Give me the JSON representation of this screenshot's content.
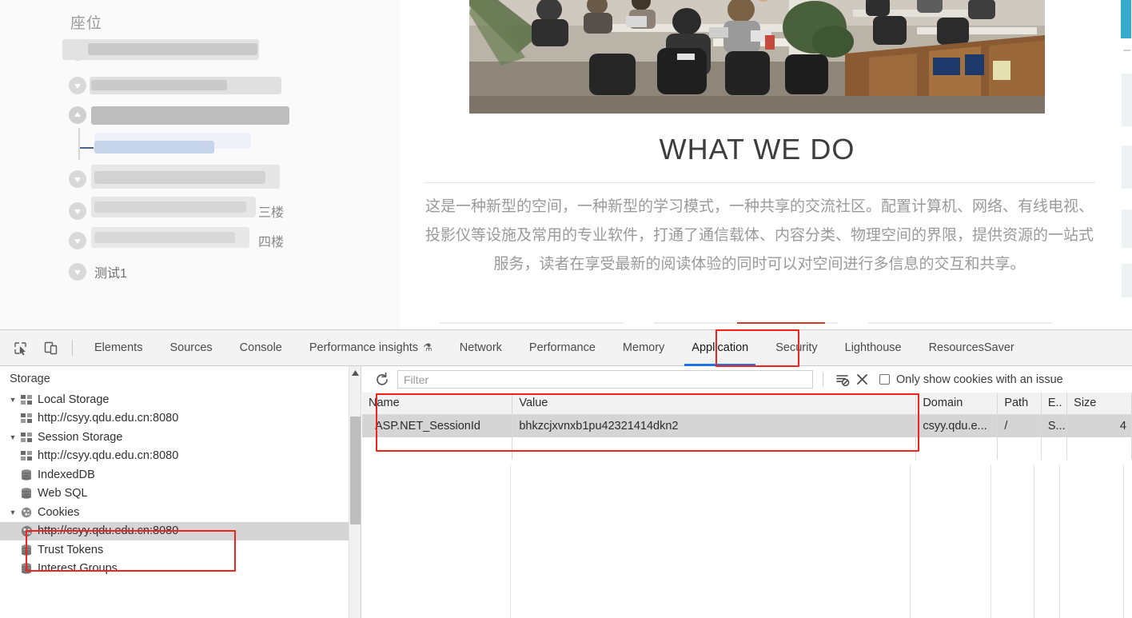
{
  "webpage": {
    "sidebar": {
      "title": "座位",
      "items": [
        {
          "label": "",
          "state": "down"
        },
        {
          "label": "",
          "state": "down"
        },
        {
          "label": "",
          "state": "up"
        },
        {
          "label": "",
          "state": "child"
        },
        {
          "label": "",
          "state": "down"
        },
        {
          "label": "三楼",
          "state": "down"
        },
        {
          "label": "四楼",
          "state": "down"
        },
        {
          "label": "测试1",
          "state": "down"
        }
      ]
    },
    "content": {
      "hero_alt": "study-space-photo",
      "heading": "WHAT WE DO",
      "paragraph": "这是一种新型的空间，一种新型的学习模式，一种共享的交流社区。配置计算机、网络、有线电视、投影仪等设施及常用的专业软件，打通了通信载体、内容分类、物理空间的界限，提供资源的一站式服务，读者在享受最新的阅读体验的同时可以对空间进行多信息的交互和共享。"
    },
    "scrollbar": {
      "thumb_color": "#36aacb"
    }
  },
  "devtools": {
    "toolbar": {
      "inspect_icon": "inspect-element-icon",
      "device_icon": "device-toolbar-icon",
      "tabs": [
        {
          "id": "elements",
          "label": "Elements",
          "active": false
        },
        {
          "id": "sources",
          "label": "Sources",
          "active": false
        },
        {
          "id": "console",
          "label": "Console",
          "active": false
        },
        {
          "id": "performance-insights",
          "label": "Performance insights",
          "active": false,
          "badge": "flask-icon"
        },
        {
          "id": "network",
          "label": "Network",
          "active": false
        },
        {
          "id": "performance",
          "label": "Performance",
          "active": false
        },
        {
          "id": "memory",
          "label": "Memory",
          "active": false
        },
        {
          "id": "application",
          "label": "Application",
          "active": true
        },
        {
          "id": "security",
          "label": "Security",
          "active": false
        },
        {
          "id": "lighthouse",
          "label": "Lighthouse",
          "active": false
        },
        {
          "id": "resources-saver",
          "label": "ResourcesSaver",
          "active": false
        }
      ],
      "active_tab_underline_color": "#1a73e8",
      "annotation_color": "#f0231e"
    },
    "storage_panel": {
      "title": "Storage",
      "tree": [
        {
          "label": "Local Storage",
          "icon": "storage-grid-icon",
          "expanded": true,
          "level": 0,
          "selected": false
        },
        {
          "label": "http://csyy.qdu.edu.cn:8080",
          "icon": "storage-grid-icon",
          "level": 1,
          "selected": false
        },
        {
          "label": "Session Storage",
          "icon": "storage-grid-icon",
          "expanded": true,
          "level": 0,
          "selected": false
        },
        {
          "label": "http://csyy.qdu.edu.cn:8080",
          "icon": "storage-grid-icon",
          "level": 1,
          "selected": false
        },
        {
          "label": "IndexedDB",
          "icon": "database-icon",
          "level": 0,
          "selected": false
        },
        {
          "label": "Web SQL",
          "icon": "database-icon",
          "level": 0,
          "selected": false
        },
        {
          "label": "Cookies",
          "icon": "cookie-icon",
          "expanded": true,
          "level": 0,
          "selected": false
        },
        {
          "label": "http://csyy.qdu.edu.cn:8080",
          "icon": "cookie-icon",
          "level": 1,
          "selected": true
        },
        {
          "label": "Trust Tokens",
          "icon": "database-icon",
          "level": 0,
          "selected": false
        },
        {
          "label": "Interest Groups",
          "icon": "database-icon",
          "level": 0,
          "selected": false
        }
      ]
    },
    "cookie_panel": {
      "refresh_icon": "refresh-icon",
      "filter": {
        "value": "",
        "placeholder": "Filter"
      },
      "clear_filter_icon": "clear-filter-icon",
      "clear_all_icon": "clear-all-cookies-icon",
      "issue_checkbox": {
        "label": "Only show cookies with an issue",
        "checked": false
      },
      "columns": [
        "Name",
        "Value",
        "Domain",
        "Path",
        "E..",
        "Size"
      ],
      "rows": [
        {
          "name": "ASP.NET_SessionId",
          "value": "bhkzcjxvnxb1pu42321414dkn2",
          "domain": "csyy.qdu.e...",
          "path": "/",
          "expires": "S...",
          "size": "4",
          "selected": true
        }
      ]
    }
  }
}
